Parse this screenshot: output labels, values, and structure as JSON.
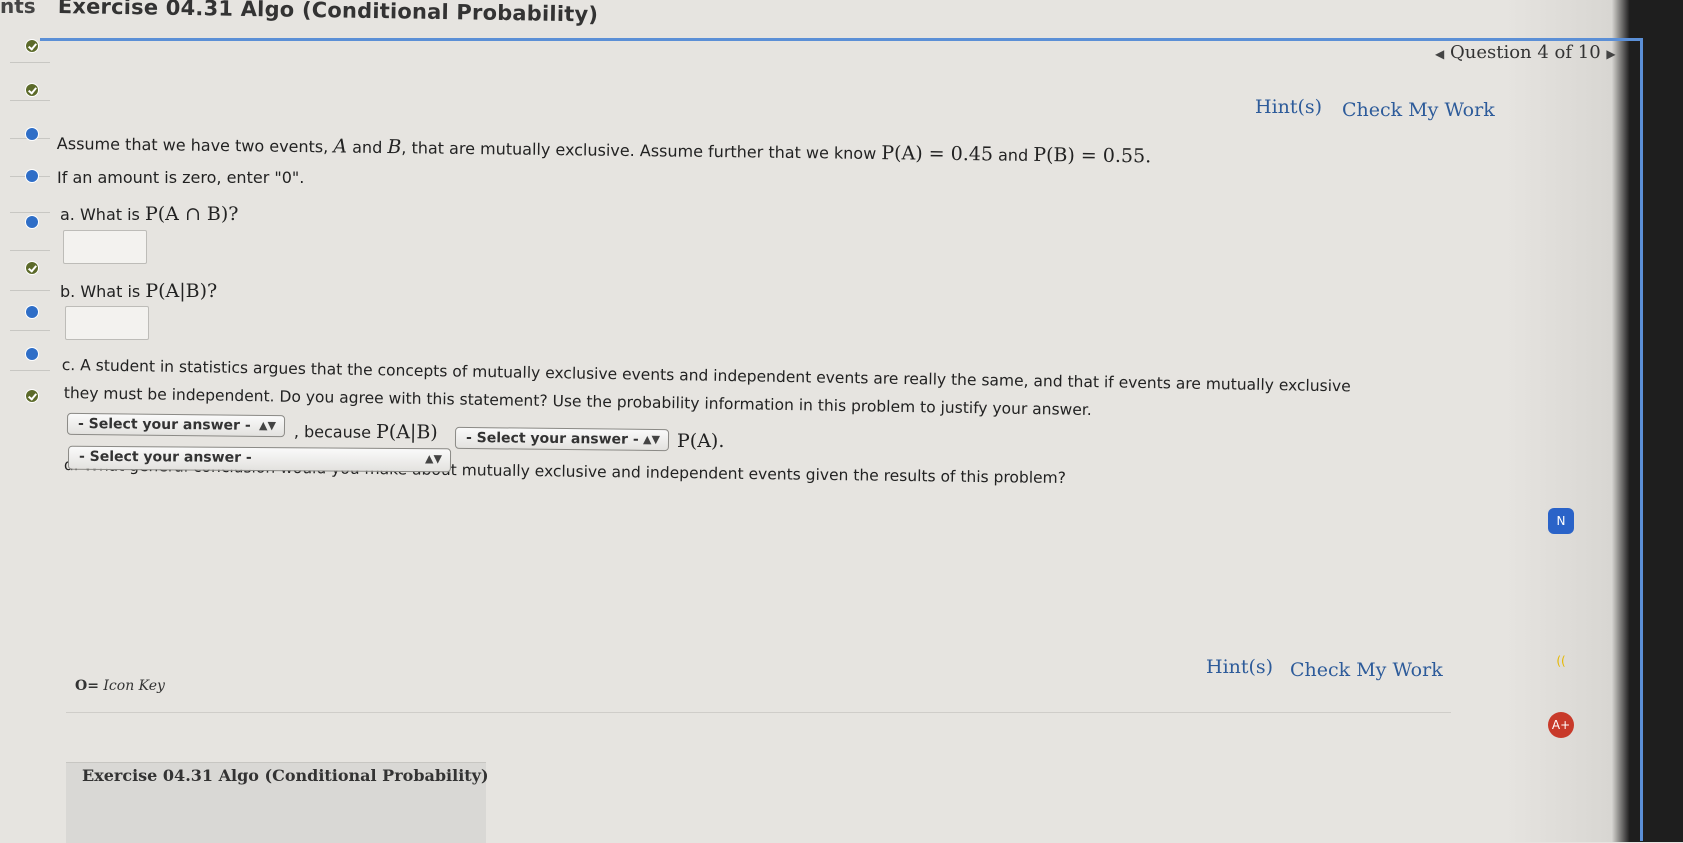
{
  "title": "Exercise 04.31 Algo (Conditional Probability)",
  "title_prefix": "nts",
  "question_nav": {
    "label": "Question 4 of 10"
  },
  "links": {
    "hint": "Hint(s)",
    "check": "Check My Work"
  },
  "problem": {
    "intro_a": "Assume that we have two events,",
    "intro_var_a": "A",
    "intro_and": "and",
    "intro_var_b": "B",
    "intro_b": ", that are mutually exclusive. Assume further that we know",
    "pa": "P(A) = 0.45",
    "and2": "and",
    "pb": "P(B) = 0.55.",
    "zero_note": "If an amount is zero, enter \"0\"."
  },
  "parts": {
    "a_label": "a. What is",
    "a_math": "P(A ∩ B)?",
    "b_label": "b. What is",
    "b_math": "P(A|B)?",
    "c_line1": "c. A student in statistics argues that the concepts of mutually exclusive events and independent events are really the same, and that if events are mutually exclusive",
    "c_line2": "they must be independent. Do you agree with this statement? Use the probability information in this problem to justify your answer.",
    "c_because": ", because",
    "c_math1": "P(A|B)",
    "c_math2": "P(A).",
    "d_line": "d. What general conclusion would you make about mutually exclusive and independent events given the results of this problem?"
  },
  "selects": {
    "c1": "- Select your answer -",
    "c2": "- Select your answer -",
    "d": "- Select your answer -"
  },
  "icon_key": "Icon Key",
  "footer_title": "Exercise 04.31 Algo (Conditional Probability)",
  "dock": {
    "n": "N",
    "aplus": "A+"
  },
  "colors": {
    "accent": "#5b8fd6",
    "link": "#2d5b9a",
    "done": "#5c6a2a",
    "current": "#2f6ec7"
  }
}
